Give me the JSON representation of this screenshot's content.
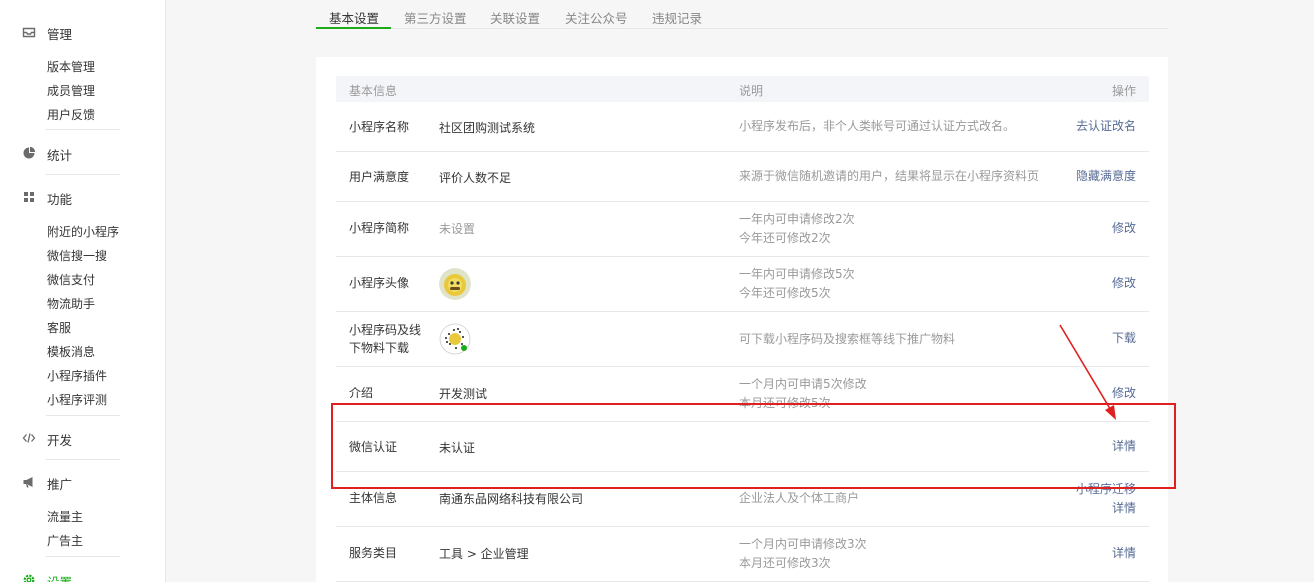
{
  "sidebar": {
    "groups": [
      {
        "icon": "folder-icon",
        "label": "管理",
        "items": [
          "版本管理",
          "成员管理",
          "用户反馈"
        ]
      },
      {
        "icon": "pie-chart-icon",
        "label": "统计",
        "items": []
      },
      {
        "icon": "grid-icon",
        "label": "功能",
        "items": [
          "附近的小程序",
          "微信搜一搜",
          "微信支付",
          "物流助手",
          "客服",
          "模板消息",
          "小程序插件",
          "小程序评测"
        ]
      },
      {
        "icon": "code-icon",
        "label": "开发",
        "items": []
      },
      {
        "icon": "megaphone-icon",
        "label": "推广",
        "items": [
          "流量主",
          "广告主"
        ]
      },
      {
        "icon": "gear-icon",
        "label": "设置",
        "items": []
      }
    ]
  },
  "tabs": [
    "基本设置",
    "第三方设置",
    "关联设置",
    "关注公众号",
    "违规记录"
  ],
  "table": {
    "headers": {
      "info": "基本信息",
      "desc": "说明",
      "op": "操作"
    },
    "rows": [
      {
        "name": "小程序名称",
        "value": "社区团购测试系统",
        "desc": [
          "小程序发布后，非个人类帐号可通过认证方式改名。"
        ],
        "ops": [
          "去认证改名"
        ]
      },
      {
        "name": "用户满意度",
        "value": "评价人数不足",
        "desc": [
          "来源于微信随机邀请的用户，结果将显示在小程序资料页"
        ],
        "ops": [
          "隐藏满意度"
        ]
      },
      {
        "name": "小程序简称",
        "value": "未设置",
        "desc": [
          "一年内可申请修改2次",
          "今年还可修改2次"
        ],
        "ops": [
          "修改"
        ]
      },
      {
        "name": "小程序头像",
        "value": "",
        "desc": [
          "一年内可申请修改5次",
          "今年还可修改5次"
        ],
        "ops": [
          "修改"
        ]
      },
      {
        "name": "小程序码及线下物料下载",
        "value": "",
        "desc": [
          "可下载小程序码及搜索框等线下推广物料"
        ],
        "ops": [
          "下载"
        ]
      },
      {
        "name": "介绍",
        "value": "开发测试",
        "desc": [
          "一个月内可申请5次修改",
          "本月还可修改5次"
        ],
        "ops": [
          "修改"
        ]
      },
      {
        "name": "微信认证",
        "value": "未认证",
        "desc": [],
        "ops": [
          "详情"
        ]
      },
      {
        "name": "主体信息",
        "value": "南通东品网络科技有限公司",
        "desc": [
          "企业法人及个体工商户"
        ],
        "ops": [
          "小程序迁移",
          "详情"
        ]
      },
      {
        "name": "服务类目",
        "value": "工具 > 企业管理",
        "desc": [
          "一个月内可申请修改3次",
          "本月还可修改3次"
        ],
        "ops": [
          "详情"
        ]
      }
    ]
  },
  "colors": {
    "accent": "#1aad19",
    "link": "#576b95",
    "annotation": "#e02020"
  }
}
